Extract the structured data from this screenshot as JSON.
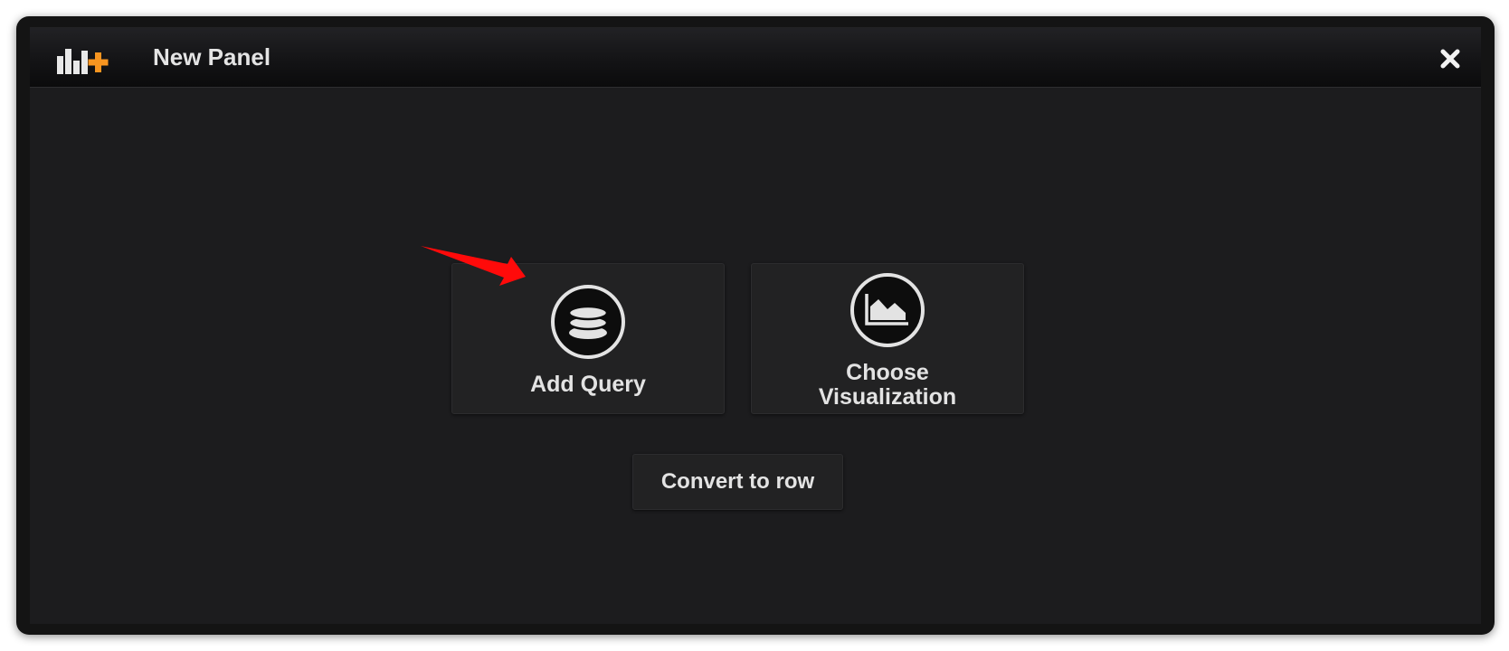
{
  "panel": {
    "title": "New Panel"
  },
  "header": {
    "logo_icon": "panel-add-icon",
    "close_icon": "close-icon"
  },
  "actions": [
    {
      "label": "Add Query",
      "icon": "database-icon"
    },
    {
      "label": "Choose\nVisualization",
      "icon": "area-chart-icon"
    }
  ],
  "convert_row_label": "Convert to row",
  "colors": {
    "accent_orange": "#f79520",
    "annotation_red": "#ff0a0a",
    "background": "#1c1c1e",
    "card": "#222223",
    "text": "#e3e3e3"
  }
}
